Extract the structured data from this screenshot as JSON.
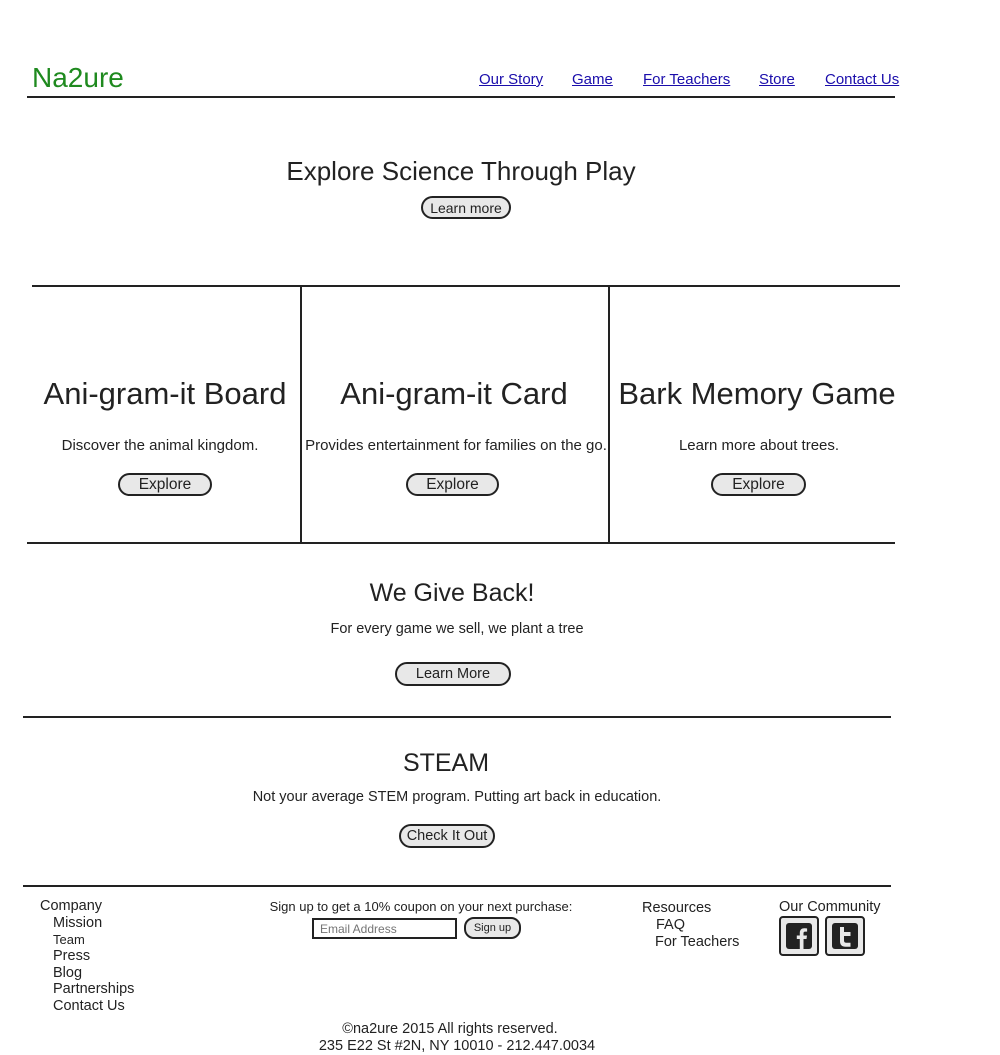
{
  "brand": {
    "logo": "Na2ure",
    "logo_color": "#1f8a1f"
  },
  "nav": [
    {
      "label": "Our Story"
    },
    {
      "label": "Game"
    },
    {
      "label": "For Teachers"
    },
    {
      "label": "Store"
    },
    {
      "label": "Contact Us"
    }
  ],
  "hero": {
    "title": "Explore Science Through Play",
    "button": "Learn more"
  },
  "products": [
    {
      "title": "Ani-gram-it Board",
      "description": "Discover the animal kingdom.",
      "button": "Explore"
    },
    {
      "title": "Ani-gram-it Card",
      "description": "Provides entertainment for families on the go.",
      "button": "Explore"
    },
    {
      "title": "Bark Memory Game",
      "description": "Learn more about trees.",
      "button": "Explore"
    }
  ],
  "give_back": {
    "title": "We Give Back!",
    "text": "For every game we sell, we plant a tree",
    "button": "Learn More"
  },
  "steam": {
    "title": "STEAM",
    "text": "Not your average STEM program. Putting art back in education.",
    "button": "Check It Out"
  },
  "footer": {
    "company": {
      "heading": "Company",
      "links": [
        "Mission",
        "Team",
        "Press",
        "Blog",
        "Partnerships",
        "Contact Us"
      ]
    },
    "signup": {
      "text": "Sign up to get a 10% coupon on your next purchase:",
      "placeholder": "Email Address",
      "button": "Sign up"
    },
    "resources": {
      "heading": "Resources",
      "links": [
        "FAQ",
        "For Teachers"
      ]
    },
    "community": {
      "heading": "Our Community",
      "icons": [
        "facebook-icon",
        "twitter-icon"
      ]
    },
    "copyright": "©na2ure 2015 All rights reserved.",
    "address": "235 E22 St #2N, NY 10010 - 212.447.0034"
  }
}
